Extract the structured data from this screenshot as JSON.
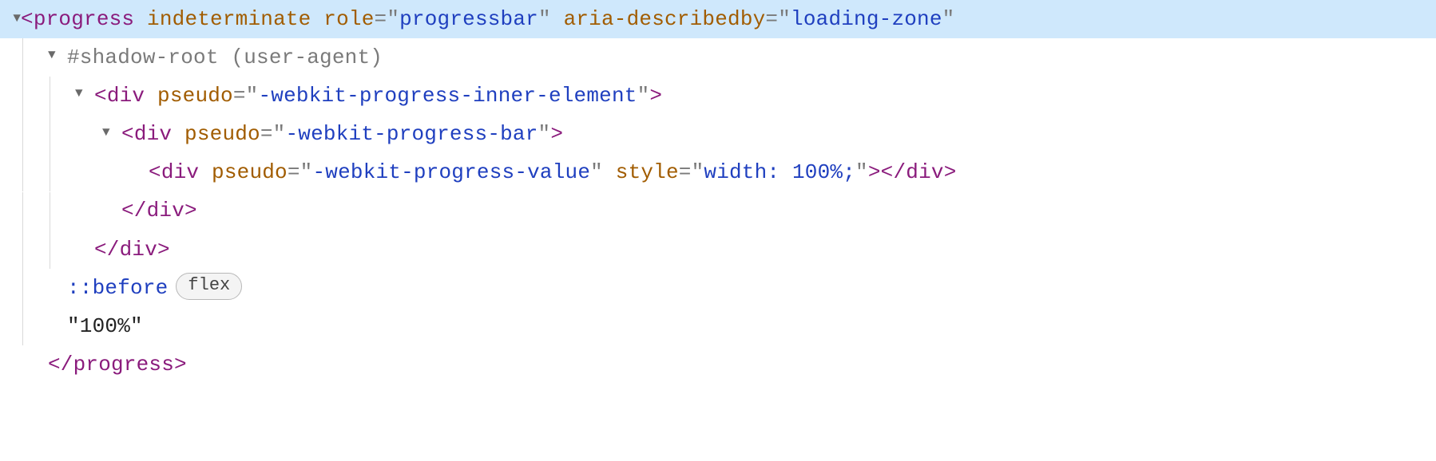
{
  "line1": {
    "tag": "progress",
    "attr1": "indeterminate",
    "attr2": "role",
    "val2": "progressbar",
    "attr3": "aria-describedby",
    "val3": "loading-zone"
  },
  "line2": {
    "text": "#shadow-root (user-agent)"
  },
  "line3": {
    "tag": "div",
    "attr": "pseudo",
    "val": "-webkit-progress-inner-element"
  },
  "line4": {
    "tag": "div",
    "attr": "pseudo",
    "val": "-webkit-progress-bar"
  },
  "line5": {
    "tag": "div",
    "attr1": "pseudo",
    "val1": "-webkit-progress-value",
    "attr2": "style",
    "val2": "width: 100%;",
    "closeTag": "div"
  },
  "line6": {
    "closeTag": "div"
  },
  "line7": {
    "closeTag": "div"
  },
  "line8": {
    "pseudo": "::before",
    "badge": "flex"
  },
  "line9": {
    "text": "\"100%\""
  },
  "line10": {
    "closeTag": "progress"
  }
}
